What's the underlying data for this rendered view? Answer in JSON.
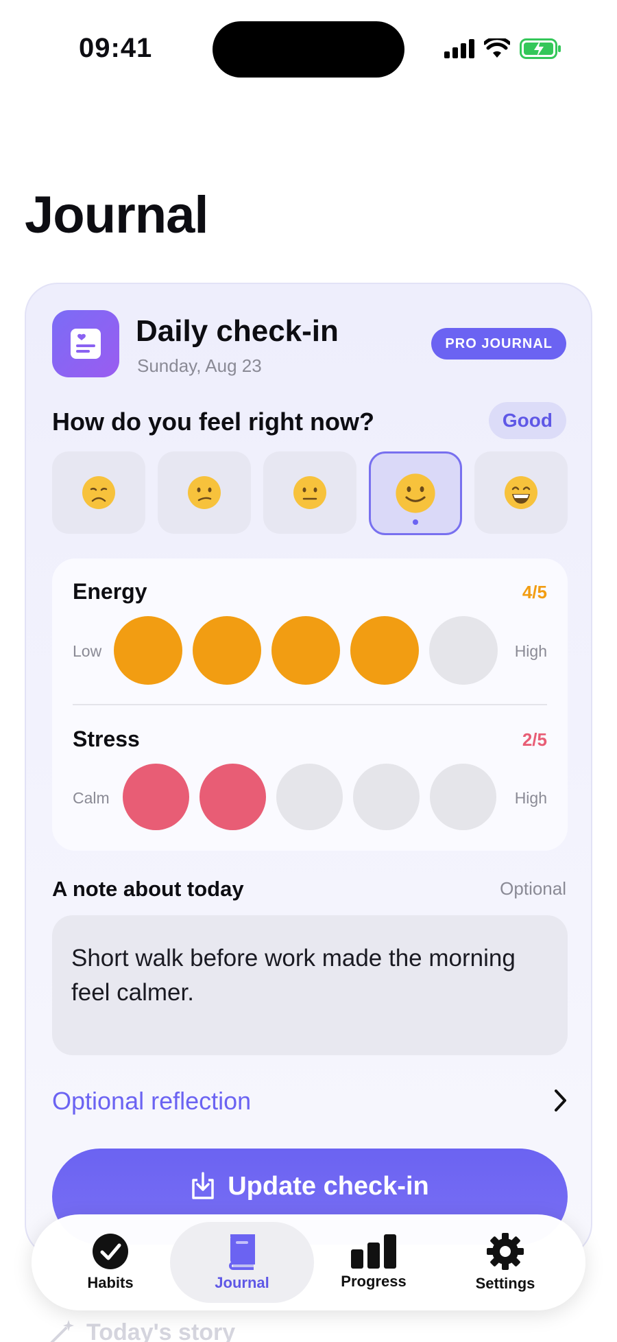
{
  "status_bar": {
    "time": "09:41"
  },
  "page_title": "Journal",
  "checkin": {
    "title": "Daily check-in",
    "date": "Sunday, Aug 23",
    "badge": "PRO JOURNAL",
    "question": "How do you feel right now?",
    "selected_mood_label": "Good",
    "moods": [
      {
        "emoji": "😞",
        "selected": false
      },
      {
        "emoji": "😕",
        "selected": false
      },
      {
        "emoji": "😐",
        "selected": false
      },
      {
        "emoji": "🙂",
        "selected": true
      },
      {
        "emoji": "😄",
        "selected": false
      }
    ]
  },
  "energy": {
    "label": "Energy",
    "value_text": "4/5",
    "value": 4,
    "max": 5,
    "low_label": "Low",
    "high_label": "High",
    "color": "#f29d12"
  },
  "stress": {
    "label": "Stress",
    "value_text": "2/5",
    "value": 2,
    "max": 5,
    "low_label": "Calm",
    "high_label": "High",
    "color": "#e85d75"
  },
  "note": {
    "label": "A note about today",
    "optional": "Optional",
    "text": "Short walk before work made the morning feel calmer."
  },
  "reflection_label": "Optional reflection",
  "update_button": "Update check-in",
  "story_label": "Today's story",
  "tabs": [
    {
      "label": "Habits",
      "icon": "checkmark-circle-icon",
      "active": false
    },
    {
      "label": "Journal",
      "icon": "book-icon",
      "active": true
    },
    {
      "label": "Progress",
      "icon": "bar-chart-icon",
      "active": false
    },
    {
      "label": "Settings",
      "icon": "gear-icon",
      "active": false
    }
  ],
  "colors": {
    "accent": "#6b63f2",
    "energy": "#f29d12",
    "stress": "#e85d75"
  }
}
